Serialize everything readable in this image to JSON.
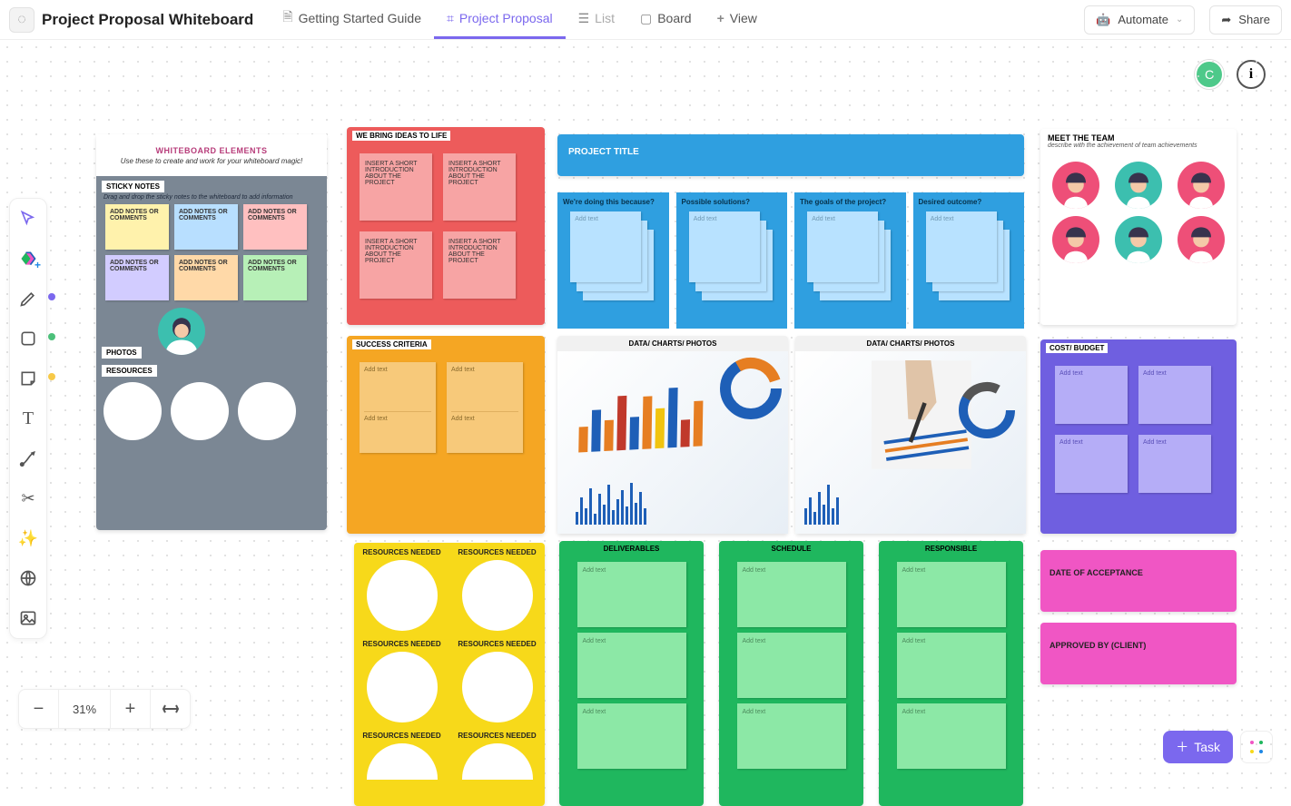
{
  "header": {
    "title": "Project Proposal Whiteboard",
    "tabs": {
      "guide": "Getting Started Guide",
      "proposal": "Project Proposal",
      "list": "List",
      "board": "Board",
      "view": "View"
    },
    "automate": "Automate",
    "share": "Share"
  },
  "avatar_letter": "C",
  "zoom": "31%",
  "task_btn": "Task",
  "elements": {
    "title": "WHITEBOARD ELEMENTS",
    "subtitle": "Use these to create and work for your whiteboard magic!",
    "sticky_lbl": "STICKY NOTES",
    "sticky_hint": "Drag and drop the sticky notes to the whiteboard to add information",
    "note_text": "ADD NOTES OR COMMENTS",
    "photos_lbl": "PHOTOS",
    "resources_lbl": "RESOURCES"
  },
  "ideas": {
    "title": "WE BRING IDEAS TO LIFE",
    "note": "INSERT A SHORT INTRODUCTION ABOUT THE PROJECT"
  },
  "project_title": "PROJECT TITLE",
  "blue_q": [
    "We're doing this because?",
    "Possible solutions?",
    "The goals of the project?",
    "Desired outcome?"
  ],
  "stack_txt": "Add text",
  "success_lbl": "SUCCESS CRITERIA",
  "photo_lbl": "DATA/ CHARTS/ PHOTOS",
  "res_needed": "RESOURCES NEEDED",
  "green_cap": [
    "DELIVERABLES",
    "SCHEDULE",
    "RESPONSIBLE"
  ],
  "team": {
    "title": "MEET THE TEAM",
    "sub": "describe with the achievement of team achievements"
  },
  "cost_lbl": "COST/ BUDGET",
  "date_lbl": "DATE OF ACCEPTANCE",
  "approved_lbl": "APPROVED BY (CLIENT)"
}
